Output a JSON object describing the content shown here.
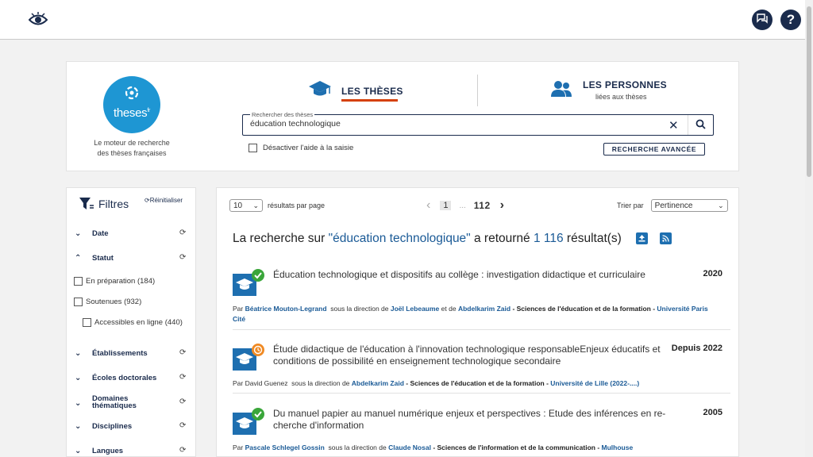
{
  "topbar": {
    "logo_icon": "eye-logo-icon",
    "chat_icon": "chat-icon",
    "help_label": "?"
  },
  "brand": {
    "name": "theses",
    "suffix": "fr",
    "subtitle_line1": "Le moteur de recherche",
    "subtitle_line2": "des thèses françaises"
  },
  "tabs": {
    "theses": "LES THÈSES",
    "persons": "LES PERSONNES",
    "persons_sub": "liées aux thèses"
  },
  "search": {
    "label": "Rechercher des thèses",
    "value": "éducation technologique",
    "assist_label": "Désactiver l'aide à la saisie",
    "advanced_label": "RECHERCHE AVANCÉE"
  },
  "filters": {
    "title": "Filtres",
    "reset": "Réinitialiser",
    "date": "Date",
    "statut": "Statut",
    "options": {
      "en_preparation": "En préparation (184)",
      "soutenues": "Soutenues (932)",
      "accessibles": "Accessibles en ligne (440)"
    },
    "etablissements": "Établissements",
    "ecoles": "Écoles doctorales",
    "domaines_1": "Domaines",
    "domaines_2": "thématiques",
    "disciplines": "Disciplines",
    "langues": "Langues"
  },
  "results": {
    "per_page_value": "10",
    "per_page_label": "résultats par page",
    "pager": {
      "prev": "‹",
      "current": "1",
      "ellipsis": "...",
      "last": "112",
      "next": "›"
    },
    "sort_label": "Trier par",
    "sort_value": "Pertinence",
    "summary": {
      "prefix": "La recherche sur ",
      "query": "\"éducation technologique\"",
      "middle": " a retourné ",
      "count": "1 116",
      "suffix": " résultat(s)"
    },
    "items": [
      {
        "title": "Éducation technologique et dispositifs au collège : investigation didactique et curriculaire",
        "year": "2020",
        "status_color": "#3aa63a",
        "by": "Par ",
        "author": "Béatrice Mouton-Legrand",
        "direction": "  sous la direction de ",
        "director1": "Joël Lebeaume",
        "and": " et de ",
        "director2": "Abdelkarim Zaid",
        "discipline": " - Sciences de l'éducation et de la formation - ",
        "institution": "Université Paris Cité"
      },
      {
        "title": "Étude didactique de l'éducation à l'innovation technologique responsableEnjeux éducatifs et conditions de possibilité en enseignement technologique secondaire",
        "year": "Depuis 2022",
        "status_color": "#f08a24",
        "by": "Par David Guenez",
        "direction": "  sous la direction de ",
        "director1": "Abdelkarim Zaid",
        "discipline": " - Sciences de l'éducation et de la formation - ",
        "institution": "Université de Lille (2022-....)"
      },
      {
        "title": "Du manuel papier au manuel numérique enjeux et perspectives : Etude des inférences en re-cherche d'information",
        "year": "2005",
        "status_color": "#3aa63a",
        "by": "Par ",
        "author": "Pascale Schlegel Gossin",
        "direction": "  sous la direction de ",
        "director1": "Claude Nosal",
        "discipline": " - Sciences de l'information et de la communication - ",
        "institution": "Mulhouse"
      }
    ]
  }
}
